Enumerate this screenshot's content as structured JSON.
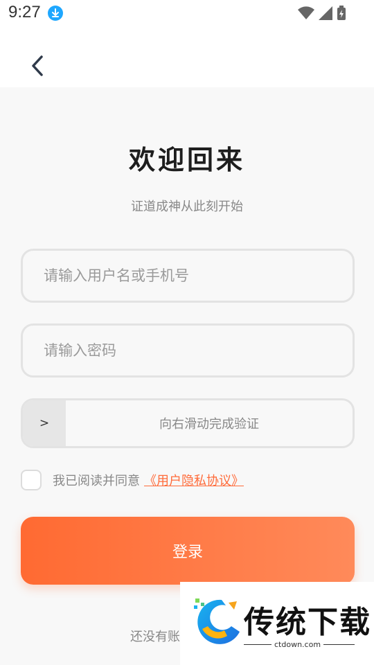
{
  "status_bar": {
    "time": "9:27"
  },
  "page": {
    "title": "欢迎回来",
    "subtitle": "证道成神从此刻开始"
  },
  "form": {
    "username_placeholder": "请输入用户名或手机号",
    "password_placeholder": "请输入密码",
    "slider_handle": ">",
    "slider_text": "向右滑动完成验证",
    "agreement_text": "我已阅读并同意",
    "agreement_link": "《用户隐私协议》",
    "agreement_checked": false,
    "login_label": "登录"
  },
  "footer": {
    "register_text": "还没有账"
  },
  "watermark": {
    "brand": "传统下载",
    "url": "ctdown.com"
  },
  "colors": {
    "accent": "#ff6a32",
    "link": "#ff6b3a",
    "download_badge": "#1ea7ff"
  }
}
